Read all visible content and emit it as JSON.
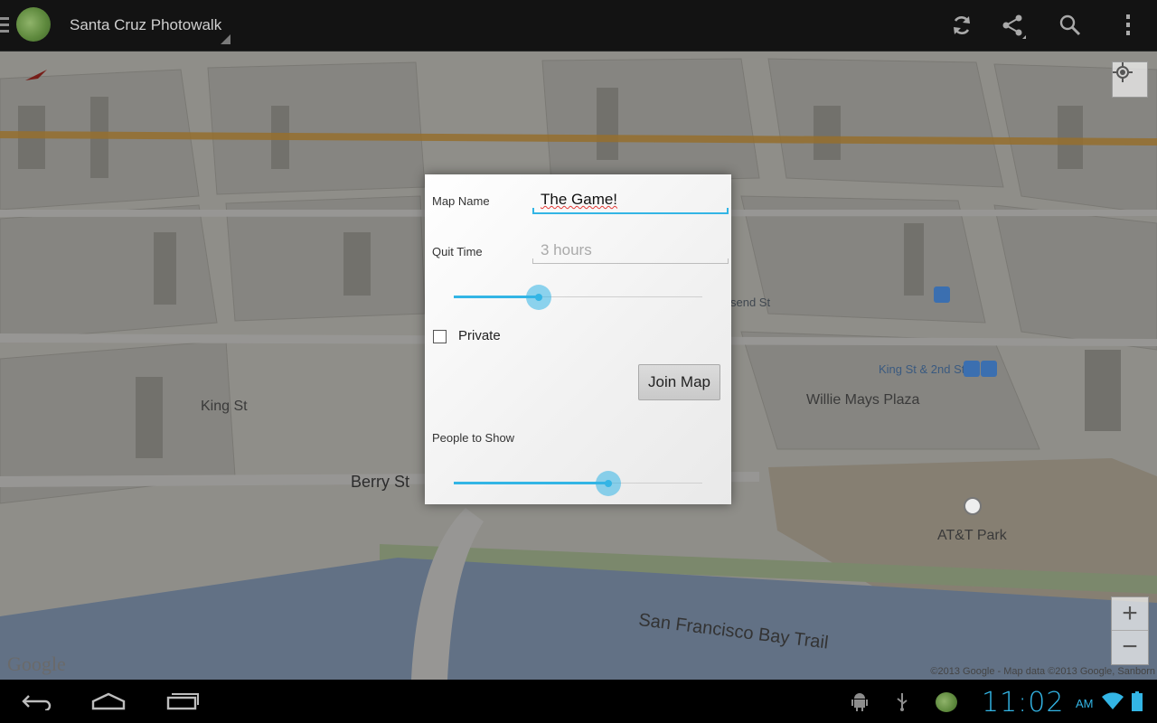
{
  "action_bar": {
    "app_title": "Santa Cruz Photowalk",
    "actions": [
      "refresh-icon",
      "share-icon",
      "search-icon",
      "overflow-menu-icon"
    ]
  },
  "map": {
    "labels": {
      "king_st": "King St",
      "berry_st": "Berry St",
      "townsend_st": "send St",
      "king_2nd": "King St & 2nd St",
      "willie_mays": "Willie Mays Plaza",
      "att_park": "AT&T Park",
      "bay_trail": "San Francisco Bay Trail"
    },
    "logo": "Google",
    "copyright": "©2013 Google - Map data ©2013 Google, Sanborn",
    "zoom_in": "+",
    "zoom_out": "−"
  },
  "dialog": {
    "map_name_label": "Map Name",
    "map_name_value": "The Game!",
    "quit_time_label": "Quit Time",
    "quit_time_placeholder": "3 hours",
    "quit_time_slider_fraction": 0.34,
    "private_label": "Private",
    "private_checked": false,
    "join_button": "Join Map",
    "people_label": "People to Show",
    "people_slider_fraction": 0.62
  },
  "status_bar": {
    "time": "11:02",
    "ampm": "AM"
  },
  "colors": {
    "accent": "#33b5e5",
    "action_bar": "#131313"
  }
}
